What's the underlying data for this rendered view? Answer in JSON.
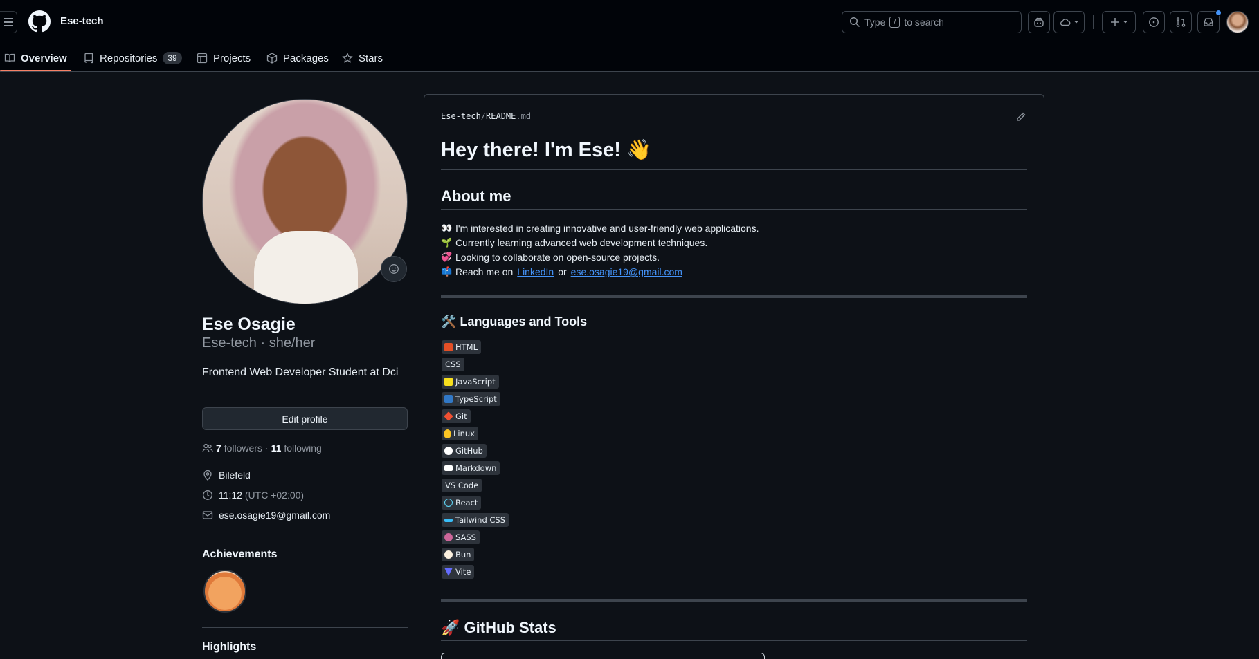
{
  "header": {
    "title": "Ese-tech",
    "search": {
      "prefix": "Type",
      "key": "/",
      "suffix": "to search"
    }
  },
  "tabs": [
    {
      "label": "Overview",
      "icon": "book-icon"
    },
    {
      "label": "Repositories",
      "count": "39",
      "icon": "repo-icon"
    },
    {
      "label": "Projects",
      "icon": "table-icon"
    },
    {
      "label": "Packages",
      "icon": "package-icon"
    },
    {
      "label": "Stars",
      "icon": "star-icon"
    }
  ],
  "profile": {
    "name": "Ese Osagie",
    "handle": "Ese-tech · she/her",
    "bio": "Frontend Web Developer Student at Dci",
    "edit_label": "Edit profile",
    "followers_count": "7",
    "followers_label": "followers",
    "following_count": "11",
    "following_label": "following",
    "separator": "·",
    "location": "Bilefeld",
    "time": "11:12",
    "timezone": "(UTC +02:00)",
    "email": "ese.osagie19@gmail.com",
    "achievements_title": "Achievements",
    "highlights_title": "Highlights"
  },
  "readme": {
    "crumb_owner": "Ese-tech",
    "crumb_sep": "/",
    "crumb_file": "README",
    "crumb_ext": ".md",
    "title": "Hey there! I'm Ese!",
    "title_emoji": "👋",
    "about_title": "About me",
    "about_lines": [
      {
        "emoji": "👀",
        "text": "I'm interested in creating innovative and user-friendly web applications."
      },
      {
        "emoji": "🌱",
        "text": "Currently learning advanced web development techniques."
      },
      {
        "emoji": "💞",
        "text": "Looking to collaborate on open-source projects."
      }
    ],
    "reach": {
      "emoji": "📫",
      "pre": "Reach me on",
      "link1": "LinkedIn",
      "mid": "or",
      "link2": "ese.osagie19@gmail.com"
    },
    "tools_title": "Languages and Tools",
    "tools_emoji": "🛠️",
    "tools": [
      {
        "label": "HTML",
        "color": "#e34f26"
      },
      {
        "label": "CSS",
        "color": ""
      },
      {
        "label": "JavaScript",
        "color": "#f7df1e"
      },
      {
        "label": "TypeScript",
        "color": "#3178c6"
      },
      {
        "label": "Git",
        "color": "#f05032"
      },
      {
        "label": "Linux",
        "color": "#fcc624"
      },
      {
        "label": "GitHub",
        "color": "#ffffff"
      },
      {
        "label": "Markdown",
        "color": "#ffffff"
      },
      {
        "label": "VS Code",
        "color": ""
      },
      {
        "label": "React",
        "color": "#61dafb"
      },
      {
        "label": "Tailwind CSS",
        "color": "#38bdf8"
      },
      {
        "label": "SASS",
        "color": "#cc6699"
      },
      {
        "label": "Bun",
        "color": "#fbf0df"
      },
      {
        "label": "Vite",
        "color": "#646cff"
      }
    ],
    "stats_title": "GitHub Stats",
    "stats_emoji": "🚀"
  }
}
